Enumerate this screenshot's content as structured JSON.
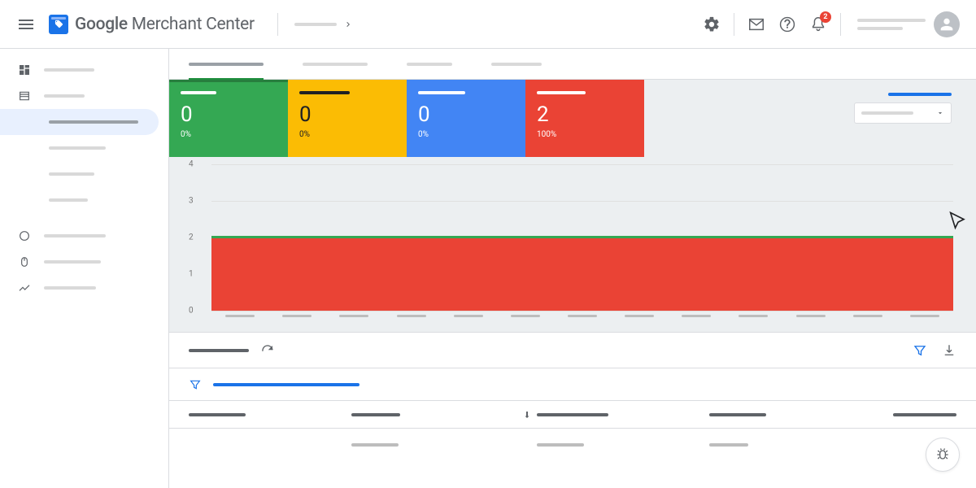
{
  "app": {
    "title_main": "Google",
    "title_rest": " Merchant Center"
  },
  "header": {
    "notification_count": "2"
  },
  "cards": [
    {
      "color": "green",
      "value": "0",
      "pct": "0%"
    },
    {
      "color": "yellow",
      "value": "0",
      "pct": "0%"
    },
    {
      "color": "blue",
      "value": "0",
      "pct": "0%"
    },
    {
      "color": "red",
      "value": "2",
      "pct": "100%"
    }
  ],
  "chart_data": {
    "type": "area",
    "categories": [
      "",
      "",
      "",
      "",
      "",
      "",
      "",
      "",
      "",
      "",
      "",
      "",
      ""
    ],
    "series": [
      {
        "name": "red",
        "values": [
          2,
          2,
          2,
          2,
          2,
          2,
          2,
          2,
          2,
          2,
          2,
          2,
          2
        ]
      },
      {
        "name": "green",
        "values": [
          2,
          2,
          2,
          2,
          2,
          2,
          2,
          2,
          2,
          2,
          2,
          2,
          2
        ]
      }
    ],
    "y_ticks": [
      0,
      1,
      2,
      3,
      4
    ],
    "ylim": [
      0,
      4
    ],
    "title": "",
    "xlabel": "",
    "ylabel": ""
  }
}
